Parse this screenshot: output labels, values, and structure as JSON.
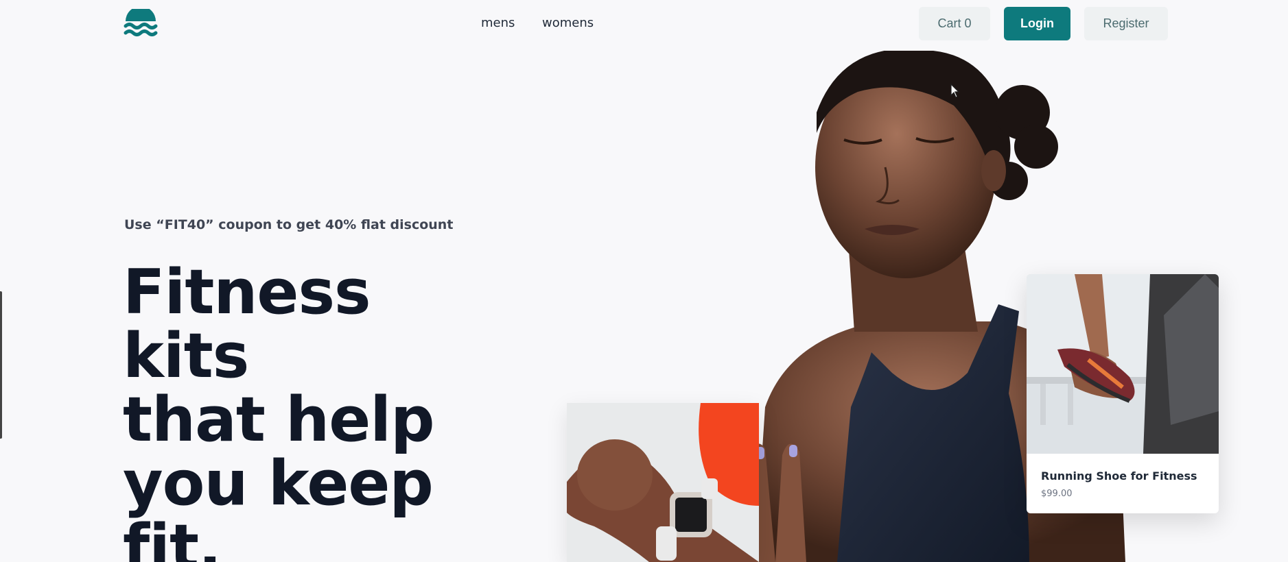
{
  "nav": {
    "links": [
      "mens",
      "womens"
    ],
    "cart_label": "Cart 0",
    "login_label": "Login",
    "register_label": "Register"
  },
  "hero": {
    "coupon_text": "Use “FIT40” coupon to get 40% flat discount",
    "headline_lines": [
      "Fitness kits",
      "that help",
      "you keep",
      "fit."
    ]
  },
  "product_card": {
    "name": "Running Shoe for Fitness",
    "price": "$99.00"
  },
  "colors": {
    "brand": "#0e7a7d",
    "text_dark": "#111827",
    "button_light": "#eef1f2"
  }
}
